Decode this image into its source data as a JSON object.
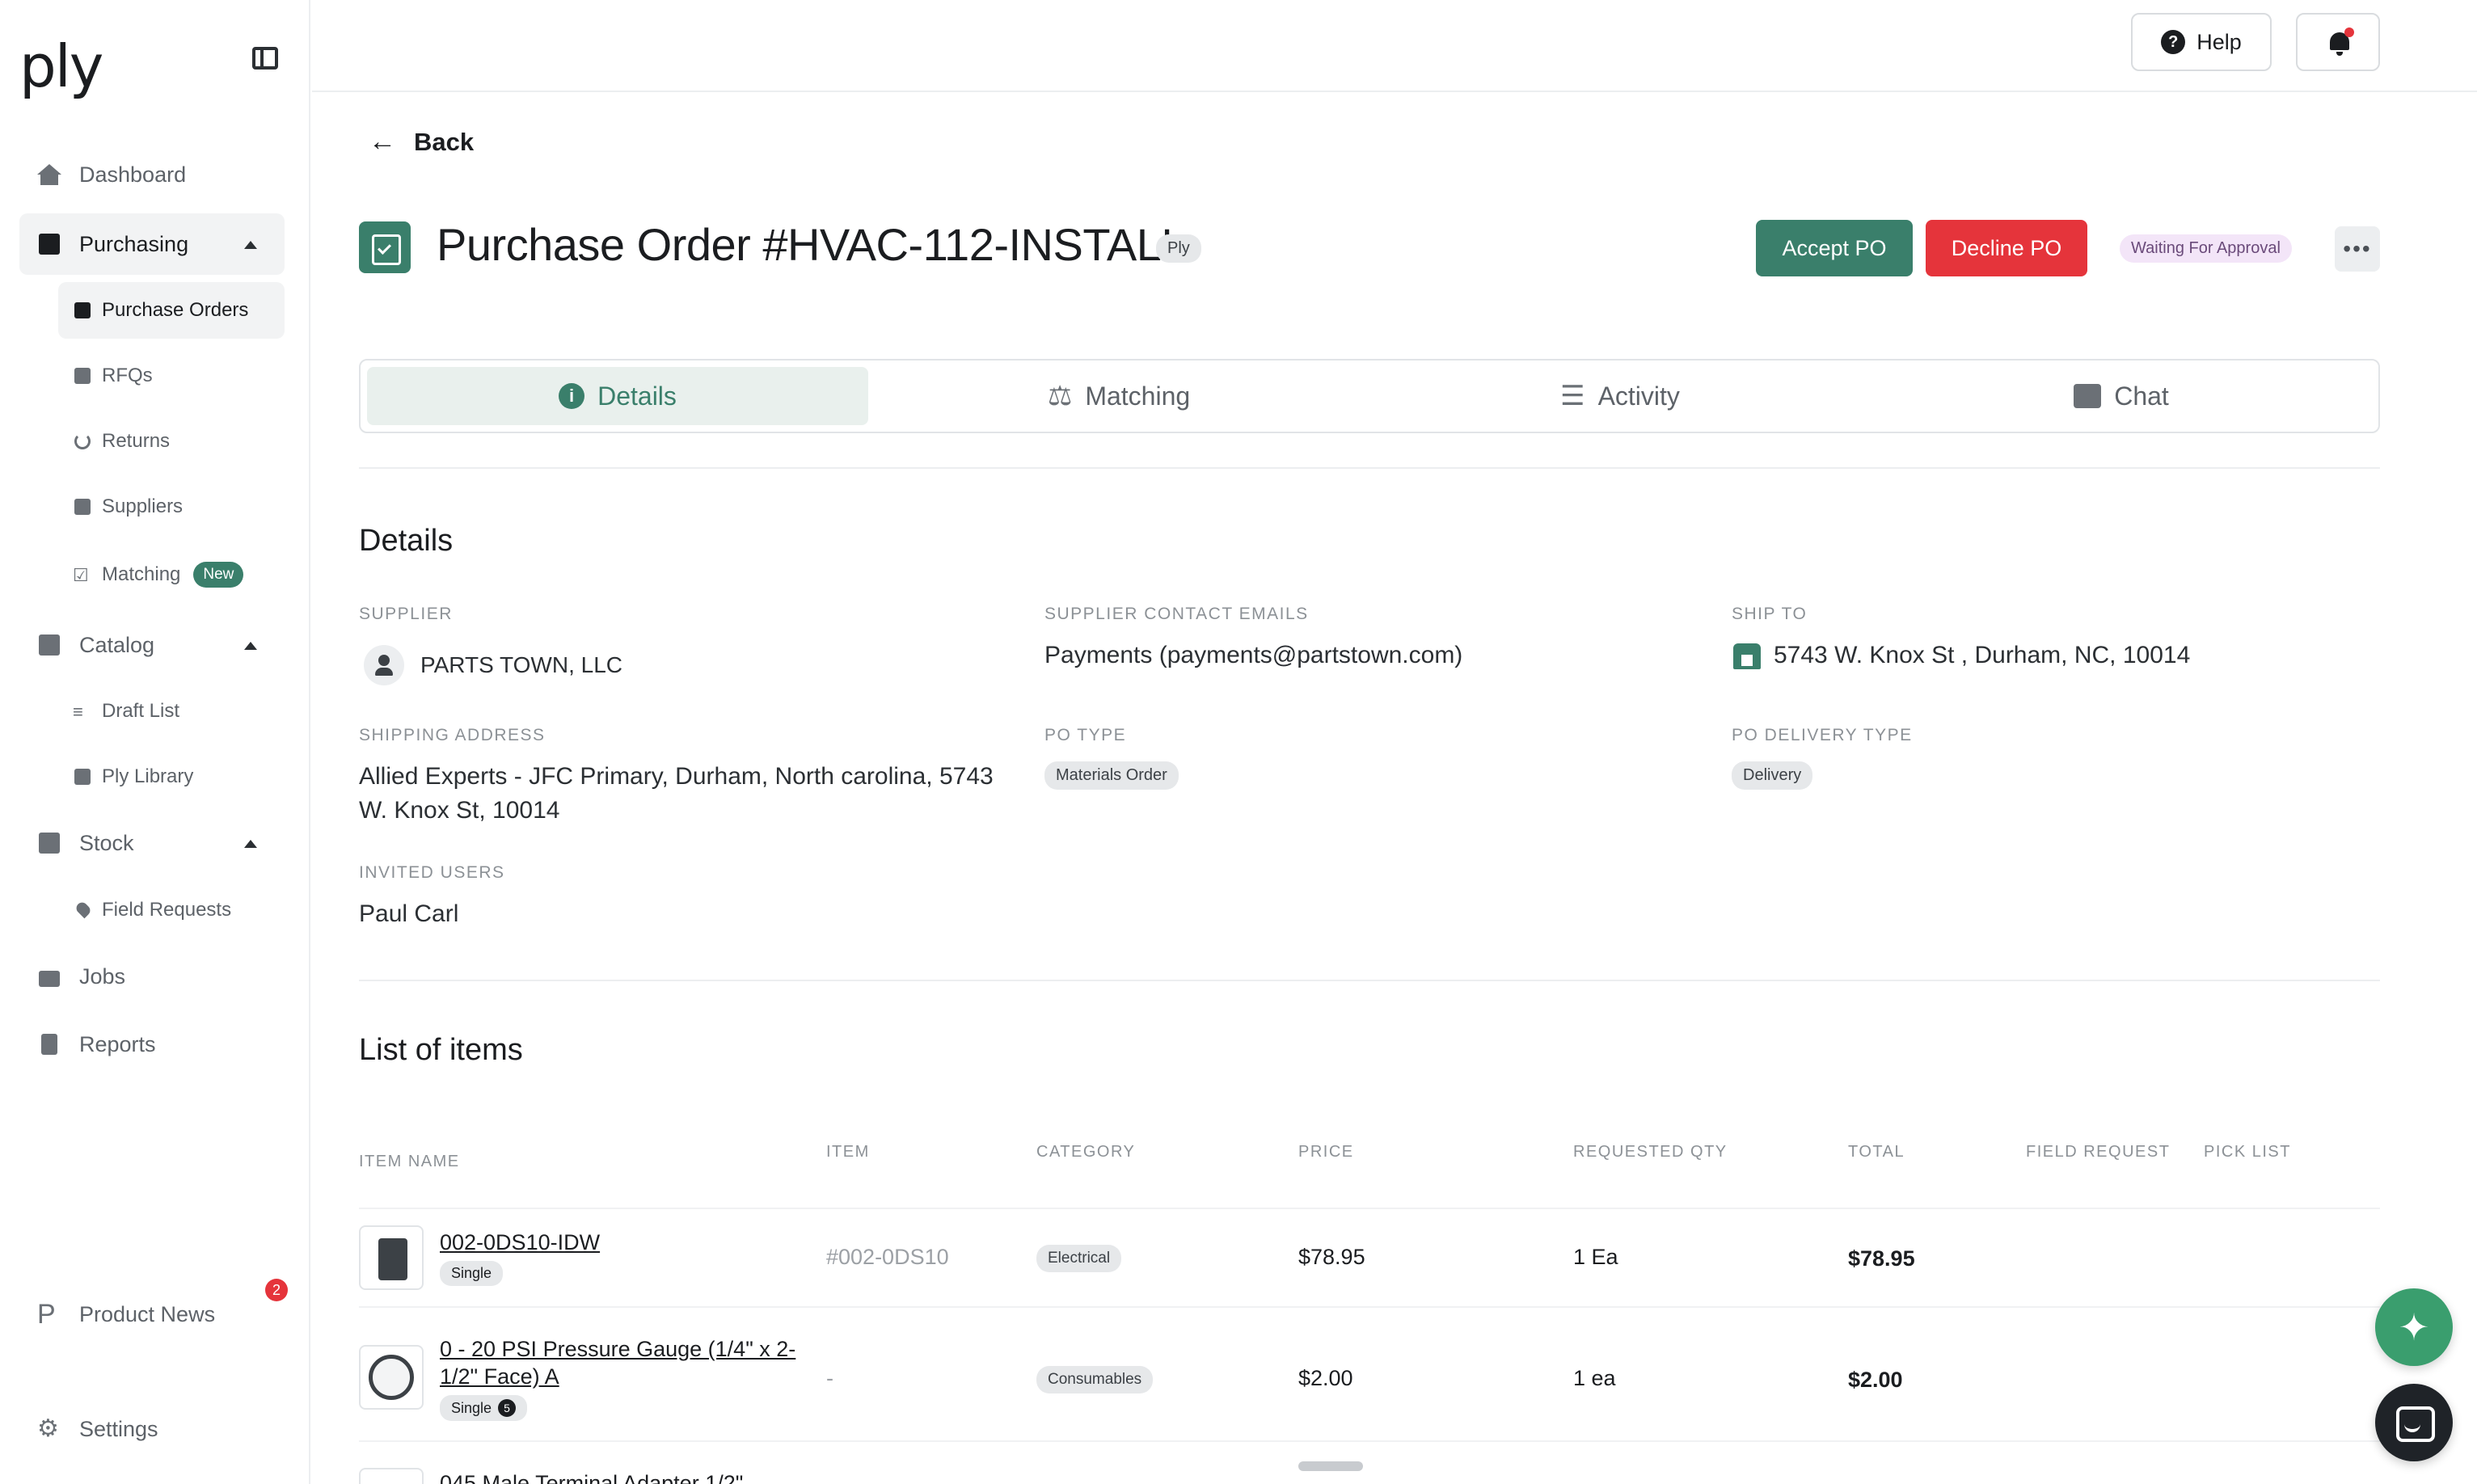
{
  "app": {
    "logo": "ply"
  },
  "sidebar": {
    "items": [
      {
        "label": "Dashboard",
        "icon": "home-icon"
      },
      {
        "label": "Purchasing",
        "icon": "purchasing-icon"
      },
      {
        "label": "Catalog",
        "icon": "catalog-icon"
      },
      {
        "label": "Stock",
        "icon": "warehouse-icon"
      },
      {
        "label": "Jobs",
        "icon": "briefcase-icon"
      },
      {
        "label": "Reports",
        "icon": "document-icon"
      }
    ],
    "purchasing_sub": [
      {
        "label": "Purchase Orders"
      },
      {
        "label": "RFQs"
      },
      {
        "label": "Returns"
      },
      {
        "label": "Suppliers"
      },
      {
        "label": "Matching",
        "badge": "New"
      }
    ],
    "catalog_sub": [
      {
        "label": "Draft List"
      },
      {
        "label": "Ply Library"
      }
    ],
    "stock_sub": [
      {
        "label": "Field Requests"
      }
    ],
    "product_news": {
      "label": "Product News",
      "count": "2"
    },
    "settings": {
      "label": "Settings"
    }
  },
  "topbar": {
    "help_label": "Help"
  },
  "header": {
    "back_label": "Back",
    "title": "Purchase Order #HVAC-112-INSTALL",
    "source_tag": "Ply",
    "accept_label": "Accept PO",
    "decline_label": "Decline PO",
    "status": "Waiting For Approval",
    "more": "•••"
  },
  "tabs": [
    {
      "label": "Details"
    },
    {
      "label": "Matching"
    },
    {
      "label": "Activity"
    },
    {
      "label": "Chat"
    }
  ],
  "details": {
    "title": "Details",
    "supplier_label": "SUPPLIER",
    "supplier": "PARTS TOWN, LLC",
    "contact_label": "SUPPLIER CONTACT EMAILS",
    "contact": "Payments (payments@partstown.com)",
    "ship_to_label": "SHIP TO",
    "ship_to": "5743 W. Knox St , Durham, NC, 10014",
    "shipping_address_label": "SHIPPING ADDRESS",
    "shipping_address": "Allied Experts - JFC Primary, Durham, North carolina, 5743 W. Knox St, 10014",
    "po_type_label": "PO TYPE",
    "po_type": "Materials Order",
    "delivery_type_label": "PO DELIVERY TYPE",
    "delivery_type": "Delivery",
    "invited_label": "INVITED USERS",
    "invited": "Paul Carl"
  },
  "items": {
    "title": "List of items",
    "columns": [
      "ITEM NAME",
      "ITEM",
      "CATEGORY",
      "PRICE",
      "REQUESTED QTY",
      "TOTAL",
      "FIELD REQUEST",
      "PICK LIST"
    ],
    "rows": [
      {
        "name": "002-0DS10-IDW",
        "tag": "Single",
        "item": "#002-0DS10",
        "category": "Electrical",
        "price": "$78.95",
        "qty": "1 Ea",
        "total": "$78.95"
      },
      {
        "name": "0 - 20 PSI Pressure Gauge (1/4\" x 2-1/2\" Face) A",
        "tag": "Single",
        "tag_count": "5",
        "item": "-",
        "category": "Consumables",
        "price": "$2.00",
        "qty": "1 ea",
        "total": "$2.00"
      },
      {
        "name": "045 Male Terminal Adapter 1/2\""
      }
    ]
  }
}
